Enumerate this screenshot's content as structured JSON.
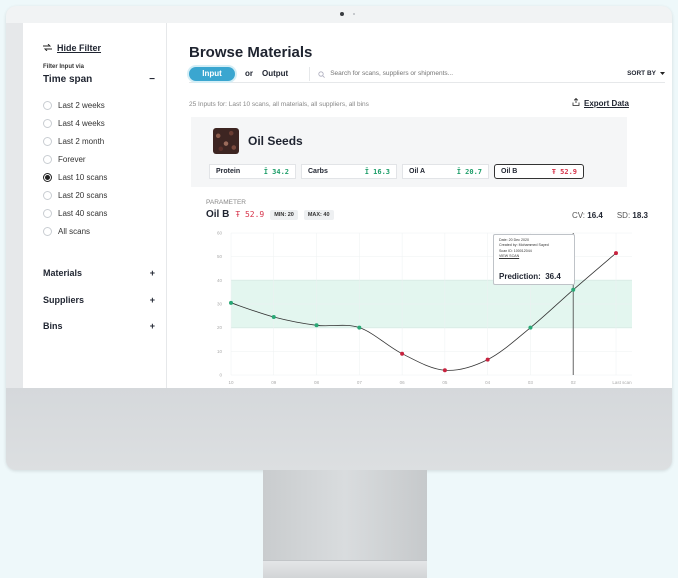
{
  "sidebar": {
    "hide_filter": "Hide Filter",
    "filter_input_via": "Filter Input via",
    "time_span": {
      "title": "Time span",
      "toggle": "−",
      "options": [
        "Last 2 weeks",
        "Last 4 weeks",
        "Last 2 month",
        "Forever",
        "Last 10 scans",
        "Last 20 scans",
        "Last 40 scans",
        "All scans"
      ],
      "selected": "Last 10 scans"
    },
    "sections": [
      {
        "title": "Materials",
        "toggle": "+"
      },
      {
        "title": "Suppliers",
        "toggle": "+"
      },
      {
        "title": "Bins",
        "toggle": "+"
      }
    ]
  },
  "main": {
    "title": "Browse Materials",
    "toggle": {
      "input": "Input",
      "or": "or",
      "output": "Output"
    },
    "search_placeholder": "Search for scans, suppliers or shipments...",
    "sort_by": "SORT BY",
    "summary": "25 Inputs for: Last 10 scans, all materials, all suppliers, all bins",
    "export": "Export Data",
    "material": {
      "name": "Oil Seeds",
      "nutrients": [
        {
          "name": "Protein",
          "value": "34.2",
          "status": "ok"
        },
        {
          "name": "Carbs",
          "value": "16.3",
          "status": "ok"
        },
        {
          "name": "Oil A",
          "value": "20.7",
          "status": "ok"
        },
        {
          "name": "Oil B",
          "value": "52.9",
          "status": "alert"
        }
      ]
    },
    "parameter": {
      "label": "PARAMETER",
      "name": "Oil B",
      "value": "52.9",
      "min": "MIN: 20",
      "max": "MAX: 40",
      "cv_label": "CV:",
      "cv": "16.4",
      "sd_label": "SD:",
      "sd": "18.3"
    },
    "tooltip": {
      "date": "Date: 20 Dec 2020",
      "created_by": "Created by: Mohammed Sayed",
      "scan_id": "Scan ID: 100012044",
      "view_scan": "VIEW SCAN",
      "prediction_label": "Prediction:",
      "prediction": "36.4"
    }
  },
  "chart_data": {
    "type": "line",
    "x": [
      "10",
      "09",
      "08",
      "07",
      "06",
      "05",
      "04",
      "03",
      "02",
      "Last scan"
    ],
    "values": [
      30.5,
      24.5,
      21,
      20,
      9,
      2,
      6.5,
      20,
      36,
      51.5
    ],
    "y_ticks": [
      0,
      10,
      20,
      30,
      40,
      50,
      60
    ],
    "ylim": [
      0,
      60
    ],
    "band": [
      20,
      40
    ],
    "highlight_index": 8,
    "grid": true,
    "colors": {
      "in_range": "#2aa876",
      "out_of_range": "#c8233f",
      "band": "#e3f6ef",
      "band_line": "#b9e4d2",
      "line": "#333333"
    }
  }
}
